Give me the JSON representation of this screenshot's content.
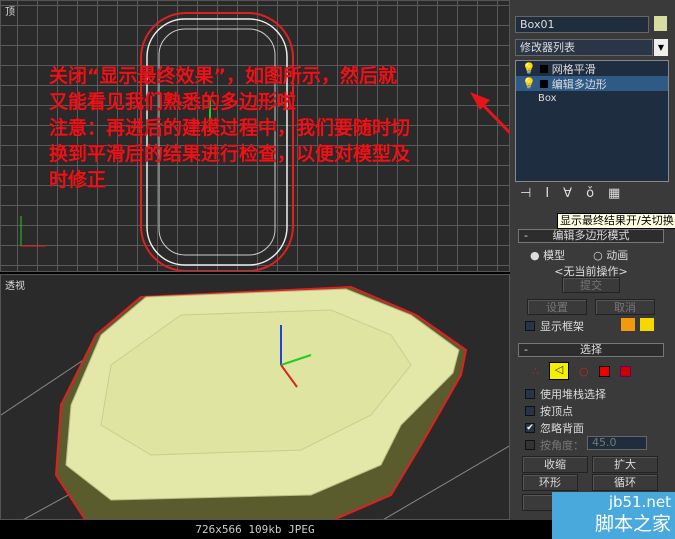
{
  "viewports": {
    "top_label": "顶",
    "persp_label": "透视"
  },
  "annotation": {
    "lines": [
      "关闭“显示最终效果”，如图所示，然后就",
      "又能看见我们熟悉的多边形啦",
      "注意：再进后的建模过程中，我们要随时切",
      "换到平滑后的结果进行检查，以便对模型及",
      "时修正"
    ]
  },
  "panel": {
    "object_name": "Box01",
    "modifier_list": "修改器列表",
    "stack": [
      "网格平滑",
      "编辑多边形",
      "Box"
    ],
    "tooltip": "显示最终结果开/关切换",
    "edit_mode_rollout": "编辑多边形模式",
    "mode_model": "模型",
    "mode_anim": "动画",
    "current_op": "<无当前操作>",
    "commit": "提交",
    "settings": "设置",
    "cancel": "取消",
    "show_cage": "显示框架",
    "selection_rollout": "选择",
    "use_stack": "使用堆栈选择",
    "by_vertex": "按顶点",
    "ignore_back": "忽略背面",
    "by_angle": "按角度：",
    "angle_value": "45.0",
    "shrink": "收缩",
    "grow": "扩大",
    "ring": "环形",
    "loop": "循环"
  },
  "status": "726x566  109kb  JPEG",
  "watermark": {
    "url": "jb51.net",
    "name": "脚本之家"
  },
  "colors": {
    "annotation": "#e5151b",
    "object": "#e3e8a9",
    "accent": "#f5d800"
  }
}
